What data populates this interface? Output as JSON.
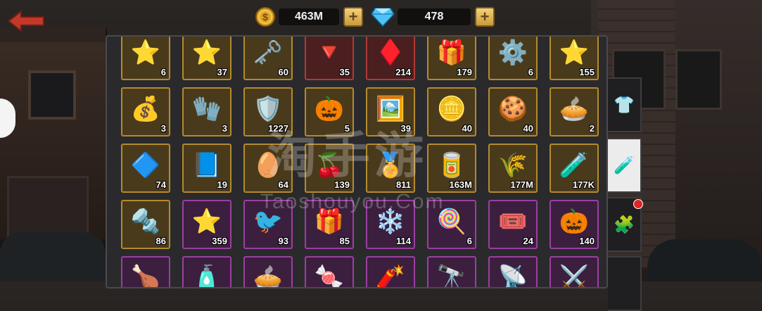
{
  "top_bar": {
    "gold": {
      "value": "463M",
      "icon": "gold-coin-icon"
    },
    "gems": {
      "value": "478",
      "icon": "blue-diamond-icon"
    },
    "plus_symbol": "+"
  },
  "inventory": {
    "rows": [
      [
        {
          "icon": "star-badge-icon",
          "glyph": "⭐",
          "qty": "6",
          "frame": "gold"
        },
        {
          "icon": "star-badge-icon",
          "glyph": "⭐",
          "qty": "37",
          "frame": "gold"
        },
        {
          "icon": "key-icon",
          "glyph": "🗝️",
          "qty": "60",
          "frame": "gold"
        },
        {
          "icon": "red-crystal-icon",
          "glyph": "🔻",
          "qty": "35",
          "frame": "red"
        },
        {
          "icon": "red-gem-icon",
          "glyph": "♦️",
          "qty": "214",
          "frame": "red"
        },
        {
          "icon": "gift-box-icon",
          "glyph": "🎁",
          "qty": "179",
          "frame": "gold"
        },
        {
          "icon": "revolver-drum-icon",
          "glyph": "⚙️",
          "qty": "6",
          "frame": "gold"
        },
        {
          "icon": "star-badge-icon",
          "glyph": "⭐",
          "qty": "155",
          "frame": "gold"
        }
      ],
      [
        {
          "icon": "gift-bag-icon",
          "glyph": "💰",
          "qty": "3",
          "frame": "gold"
        },
        {
          "icon": "mitten-icon",
          "glyph": "🧤",
          "qty": "3",
          "frame": "gold"
        },
        {
          "icon": "v-shield-icon",
          "glyph": "🛡️",
          "qty": "1227",
          "frame": "gold"
        },
        {
          "icon": "pumpkin-icon",
          "glyph": "🎃",
          "qty": "5",
          "frame": "gold"
        },
        {
          "icon": "photos-icon",
          "glyph": "🖼️",
          "qty": "39",
          "frame": "gold"
        },
        {
          "icon": "gold-coin-icon",
          "glyph": "🪙",
          "qty": "40",
          "frame": "gold"
        },
        {
          "icon": "cookies-icon",
          "glyph": "🍪",
          "qty": "40",
          "frame": "gold"
        },
        {
          "icon": "pie-icon",
          "glyph": "🥧",
          "qty": "2",
          "frame": "gold"
        }
      ],
      [
        {
          "icon": "blue-shield-icon",
          "glyph": "🔷",
          "qty": "74",
          "frame": "gold"
        },
        {
          "icon": "blueprint-icon",
          "glyph": "📘",
          "qty": "19",
          "frame": "gold"
        },
        {
          "icon": "egg-icon",
          "glyph": "🥚",
          "qty": "64",
          "frame": "gold"
        },
        {
          "icon": "cherries-icon",
          "glyph": "🍒",
          "qty": "139",
          "frame": "gold"
        },
        {
          "icon": "star-medal-icon",
          "glyph": "🏅",
          "qty": "811",
          "frame": "gold"
        },
        {
          "icon": "canister-icon",
          "glyph": "🥫",
          "qty": "163M",
          "frame": "gold"
        },
        {
          "icon": "wheat-icon",
          "glyph": "🌾",
          "qty": "177M",
          "frame": "gold"
        },
        {
          "icon": "fuel-tube-icon",
          "glyph": "🧪",
          "qty": "177K",
          "frame": "gold"
        }
      ],
      [
        {
          "icon": "metal-shard-icon",
          "glyph": "🔩",
          "qty": "86",
          "frame": "gold"
        },
        {
          "icon": "number-star-icon",
          "glyph": "⭐",
          "qty": "359",
          "frame": "purple"
        },
        {
          "icon": "bird-ornament-icon",
          "glyph": "🐦",
          "qty": "93",
          "frame": "purple"
        },
        {
          "icon": "gift-2022-icon",
          "glyph": "🎁",
          "qty": "85",
          "frame": "purple"
        },
        {
          "icon": "gingerbread-snowflake-icon",
          "glyph": "❄️",
          "qty": "114",
          "frame": "purple"
        },
        {
          "icon": "candy-cane-icon",
          "glyph": "🍭",
          "qty": "6",
          "frame": "purple"
        },
        {
          "icon": "ticket-icon",
          "glyph": "🎟️",
          "qty": "24",
          "frame": "purple"
        },
        {
          "icon": "blue-pumpkin-icon",
          "glyph": "🎃",
          "qty": "140",
          "frame": "purple"
        }
      ],
      [
        {
          "icon": "roast-turkey-icon",
          "glyph": "🍗",
          "qty": "",
          "frame": "purple"
        },
        {
          "icon": "potion-icon",
          "glyph": "🧴",
          "qty": "",
          "frame": "purple"
        },
        {
          "icon": "pie-icon",
          "glyph": "🥧",
          "qty": "",
          "frame": "purple"
        },
        {
          "icon": "candy-icon",
          "glyph": "🍬",
          "qty": "",
          "frame": "purple"
        },
        {
          "icon": "firework-rocket-icon",
          "glyph": "🧨",
          "qty": "",
          "frame": "purple"
        },
        {
          "icon": "telescope-icon",
          "glyph": "🔭",
          "qty": "",
          "frame": "purple"
        },
        {
          "icon": "satellite-dish-icon",
          "glyph": "📡",
          "qty": "",
          "frame": "purple"
        },
        {
          "icon": "crossed-tools-icon",
          "glyph": "⚔️",
          "qty": "",
          "frame": "purple"
        }
      ]
    ]
  },
  "side_tabs": [
    {
      "icon": "shirt-icon",
      "glyph": "👕",
      "active": false
    },
    {
      "icon": "potion-bottle-icon",
      "glyph": "🧪",
      "active": true
    },
    {
      "icon": "puzzle-piece-icon",
      "glyph": "🧩",
      "active": false,
      "has_notification": true
    }
  ],
  "watermark": {
    "chinese": "淘手游",
    "english": "Taoshouyou.Com"
  },
  "colors": {
    "gold_frame": "#b48a2e",
    "purple_frame": "#9a3fa0",
    "red_frame": "#b03a36",
    "back_arrow": "#c0392b",
    "active_tab": "#ececec"
  }
}
